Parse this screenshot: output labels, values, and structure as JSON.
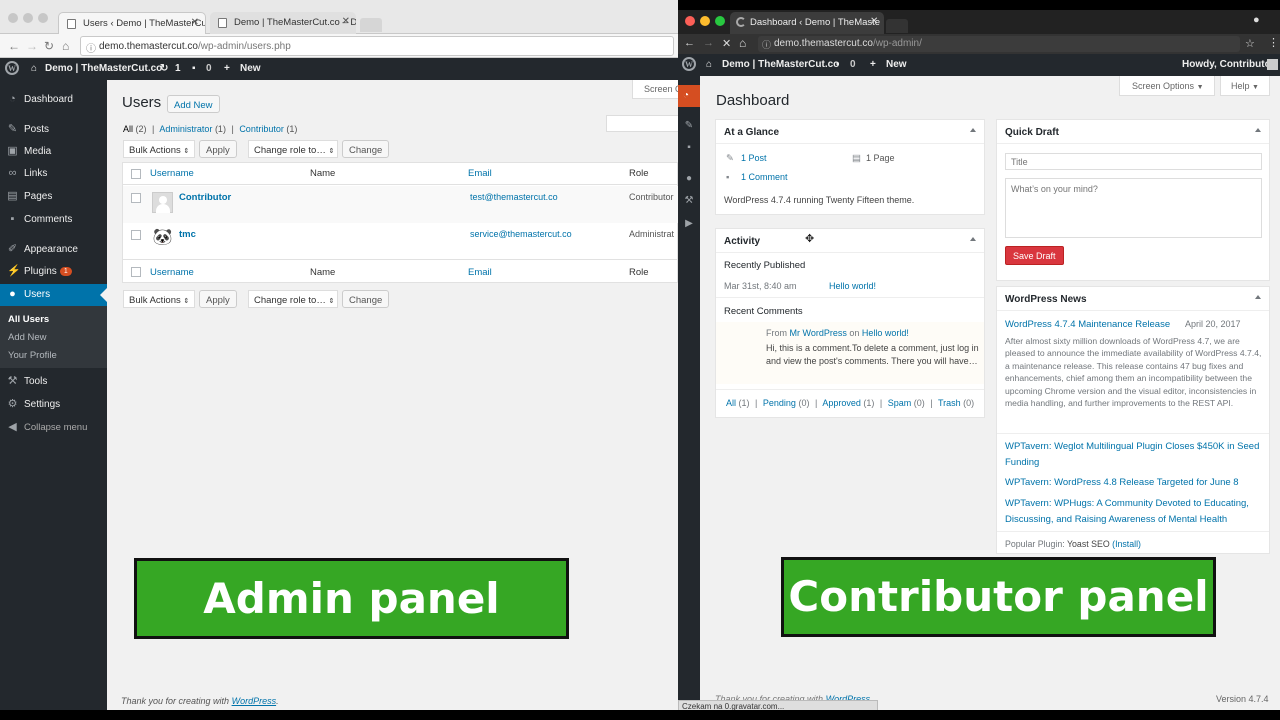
{
  "left": {
    "tabs": [
      {
        "label": "Users ‹ Demo | TheMasterCut"
      },
      {
        "label": "Demo | TheMasterCut.co – De"
      }
    ],
    "url": {
      "domain": "demo.themastercut.co",
      "path": "/wp-admin/users.php"
    },
    "adminbar": {
      "site": "Demo | TheMasterCut.co",
      "updates": "1",
      "comments": "0",
      "new": "New"
    },
    "menu": {
      "dashboard": "Dashboard",
      "posts": "Posts",
      "media": "Media",
      "links": "Links",
      "pages": "Pages",
      "comments": "Comments",
      "appearance": "Appearance",
      "plugins": "Plugins",
      "plugins_badge": "1",
      "users": "Users",
      "all_users": "All Users",
      "add_new": "Add New",
      "your_profile": "Your Profile",
      "tools": "Tools",
      "settings": "Settings",
      "collapse": "Collapse menu"
    },
    "screen_options": "Screen O",
    "page_title": "Users",
    "add_new_btn": "Add New",
    "filters": {
      "all": "All",
      "all_count": "(2)",
      "admin": "Administrator",
      "admin_count": "(1)",
      "contrib": "Contributor",
      "contrib_count": "(1)"
    },
    "bulk_actions": "Bulk Actions",
    "apply": "Apply",
    "change_role": "Change role to…",
    "change": "Change",
    "columns": {
      "username": "Username",
      "name": "Name",
      "email": "Email",
      "role": "Role"
    },
    "rows": [
      {
        "username": "Contributor",
        "name": "",
        "email": "test@themastercut.co",
        "role": "Contributor"
      },
      {
        "username": "tmc",
        "name": "",
        "email": "service@themastercut.co",
        "role": "Administrat"
      }
    ],
    "footer": {
      "text": "Thank you for creating with",
      "link": "WordPress",
      "end": "."
    },
    "overlay": "Admin panel"
  },
  "right": {
    "tab": "Dashboard ‹ Demo | TheMaste",
    "url": {
      "domain": "demo.themastercut.co",
      "path": "/wp-admin/"
    },
    "adminbar": {
      "site": "Demo | TheMasterCut.co",
      "comments": "0",
      "new": "New",
      "howdy": "Howdy, Contributor"
    },
    "screen_options": "Screen Options",
    "help": "Help",
    "page_title": "Dashboard",
    "glance": {
      "title": "At a Glance",
      "posts": "1 Post",
      "pages": "1 Page",
      "comments": "1 Comment",
      "running": "WordPress 4.7.4 running Twenty Fifteen theme."
    },
    "activity": {
      "title": "Activity",
      "recently_published": "Recently Published",
      "pub_date": "Mar 31st, 8:40 am",
      "pub_title": "Hello world!",
      "recent_comments": "Recent Comments",
      "comment_from": "From",
      "comment_author": "Mr WordPress",
      "comment_on": "on",
      "comment_post": "Hello world!",
      "comment_text": "Hi, this is a comment.To delete a comment, just log in and view the post's comments. There you will have…",
      "links": [
        {
          "label": "All",
          "count": "(1)"
        },
        {
          "label": "Pending",
          "count": "(0)"
        },
        {
          "label": "Approved",
          "count": "(1)"
        },
        {
          "label": "Spam",
          "count": "(0)"
        },
        {
          "label": "Trash",
          "count": "(0)"
        }
      ]
    },
    "quick_draft": {
      "title": "Quick Draft",
      "title_placeholder": "Title",
      "content_placeholder": "What’s on your mind?",
      "save": "Save Draft"
    },
    "news": {
      "title": "WordPress News",
      "main_title": "WordPress 4.7.4 Maintenance Release",
      "main_date": "April 20, 2017",
      "main_excerpt": "After almost sixty million downloads of WordPress 4.7, we are pleased to announce the immediate availability of WordPress 4.7.4, a maintenance release. This release contains 47 bug fixes and enhancements, chief among them an incompatibility between the upcoming Chrome version and the visual editor, inconsistencies in media handling, and further improvements to the REST API.",
      "items": [
        "WPTavern: Weglot Multilingual Plugin Closes $450K in Seed Funding",
        "WPTavern: WordPress 4.8 Release Targeted for June 8",
        "WPTavern: WPHugs: A Community Devoted to Educating, Discussing, and Raising Awareness of Mental Health"
      ],
      "popular_label": "Popular Plugin:",
      "popular_name": "Yoast SEO",
      "popular_install": "(Install)"
    },
    "footer": {
      "text": "Thank you for creating with",
      "link": "WordPress",
      "version": "Version 4.7.4"
    },
    "status": "Czekam na 0.gravatar.com...",
    "overlay": "Contributor panel"
  }
}
